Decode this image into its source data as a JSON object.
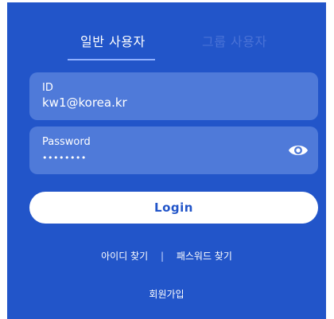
{
  "colors": {
    "background": "#2255c9",
    "field": "#4f7ad9",
    "button": "#ffffff",
    "tab_inactive": "#4a72d6"
  },
  "tabs": [
    {
      "label": "일반 사용자",
      "active": true
    },
    {
      "label": "그룹 사용자",
      "active": false
    }
  ],
  "id_field": {
    "label": "ID",
    "value": "kw1@korea.kr"
  },
  "password_field": {
    "label": "Password",
    "value": "••••••••",
    "icon": "eye-icon"
  },
  "login_button": {
    "label": "Login"
  },
  "links": {
    "find_id": "아이디 찾기",
    "separator": "|",
    "find_password": "패스워드 찾기"
  },
  "signup": {
    "label": "회원가입"
  }
}
